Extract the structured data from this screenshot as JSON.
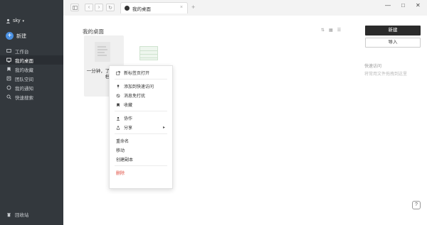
{
  "sidebar": {
    "username": "sky",
    "new_label": "新建",
    "items": [
      {
        "label": "工作台",
        "icon": "workspace-icon"
      },
      {
        "label": "我的桌面",
        "icon": "desktop-icon",
        "active": true
      },
      {
        "label": "我的收藏",
        "icon": "bookmark-icon"
      },
      {
        "label": "团队空间",
        "icon": "team-icon"
      },
      {
        "label": "我的通知",
        "icon": "bell-icon"
      },
      {
        "label": "快速搜索",
        "icon": "search-icon"
      }
    ],
    "trash_label": "回收站"
  },
  "topbar": {
    "tab_title": "我的桌面",
    "tab_close": "×",
    "add_tab": "+",
    "win_min": "—",
    "win_max": "□",
    "win_close": "✕"
  },
  "main": {
    "title": "我的桌面",
    "file_name": "一分钟，了解石墨文档",
    "new_button": "新建",
    "import_button": "导入",
    "quick_access_title": "快速访问",
    "quick_access_hint": "将常用文件拖拽到这里",
    "help": "?"
  },
  "context_menu": {
    "items": [
      {
        "label": "新标签页打开",
        "icon": "open-new-tab-icon"
      },
      {
        "label": "添加到快速访问",
        "icon": "pin-icon"
      },
      {
        "label": "消息免打扰",
        "icon": "mute-icon"
      },
      {
        "label": "收藏",
        "icon": "bookmark-icon"
      },
      {
        "label": "协作",
        "icon": "collaborate-icon"
      },
      {
        "label": "分享",
        "icon": "share-icon",
        "submenu": "▸"
      },
      {
        "label": "重命名"
      },
      {
        "label": "移动"
      },
      {
        "label": "创建副本"
      },
      {
        "label": "删除",
        "danger": true
      }
    ]
  },
  "colors": {
    "sidebar_bg": "#33383d",
    "accent": "#4a90e2",
    "danger": "#e04a3c",
    "primary_button": "#2b2b2b"
  }
}
